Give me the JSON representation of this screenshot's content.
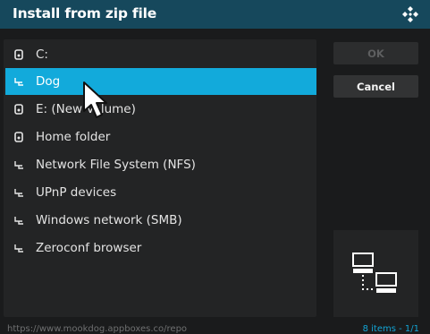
{
  "dialog": {
    "title": "Install from zip file",
    "logo": "kodi-logo-icon"
  },
  "sources": [
    {
      "label": "C:",
      "icon": "drive-icon",
      "selected": false
    },
    {
      "label": "Dog",
      "icon": "network-share-icon",
      "selected": true
    },
    {
      "label": "E: (New Volume)",
      "icon": "drive-icon",
      "selected": false
    },
    {
      "label": "Home folder",
      "icon": "drive-icon",
      "selected": false
    },
    {
      "label": "Network File System (NFS)",
      "icon": "network-share-icon",
      "selected": false
    },
    {
      "label": "UPnP devices",
      "icon": "network-share-icon",
      "selected": false
    },
    {
      "label": "Windows network (SMB)",
      "icon": "network-share-icon",
      "selected": false
    },
    {
      "label": "Zeroconf browser",
      "icon": "network-share-icon",
      "selected": false
    }
  ],
  "buttons": {
    "ok_label": "OK",
    "ok_enabled": false,
    "cancel_label": "Cancel"
  },
  "preview": {
    "icon": "network-computers-icon"
  },
  "footer": {
    "path": "https://www.mookdog.appboxes.co/repo",
    "count": "8 items - 1/1"
  },
  "colors": {
    "title_bar": "#16485c",
    "selection": "#12aadb",
    "footer_count": "#12a5d6"
  }
}
